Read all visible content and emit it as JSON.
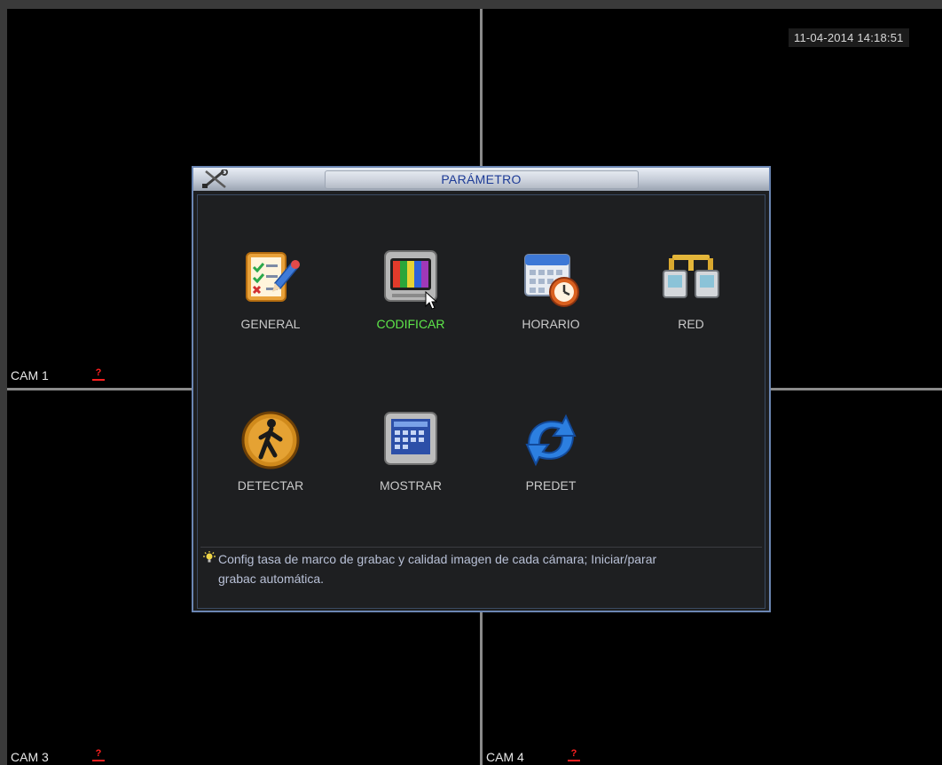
{
  "clock": "11-04-2014 14:18:51",
  "cameras": [
    {
      "label": "CAM 1",
      "alarm_icon": "record-alarm-icon"
    },
    {
      "label": "CAM 3",
      "alarm_icon": "record-alarm-icon"
    },
    {
      "label": "CAM 4",
      "alarm_icon": "record-alarm-icon"
    }
  ],
  "dialog": {
    "title": "PARÁMETRO",
    "title_icon": "tools-icon",
    "items": [
      {
        "label": "GENERAL",
        "icon": "checklist-icon",
        "active": false
      },
      {
        "label": "CODIFICAR",
        "icon": "color-bars-tv-icon",
        "active": true
      },
      {
        "label": "HORARIO",
        "icon": "calendar-clock-icon",
        "active": false
      },
      {
        "label": "RED",
        "icon": "network-icon",
        "active": false
      },
      {
        "label": "DETECTAR",
        "icon": "motion-person-icon",
        "active": false
      },
      {
        "label": "MOSTRAR",
        "icon": "display-monitor-icon",
        "active": false
      },
      {
        "label": "PREDET",
        "icon": "reset-arrows-icon",
        "active": false
      }
    ],
    "help_text_line1": "Config tasa de marco de grabac y calidad imagen de cada cámara; Iniciar/parar",
    "help_text_line2": "grabac automática."
  },
  "colors": {
    "active_label": "#5ee64a",
    "label": "#c9c9c9",
    "title": "#1c3a96",
    "alarm": "#ff2020"
  }
}
